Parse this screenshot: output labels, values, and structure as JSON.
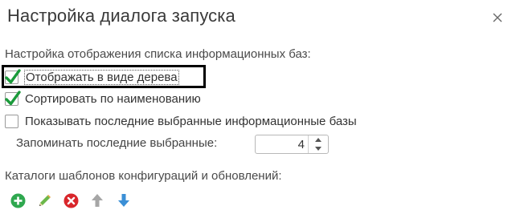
{
  "dialog": {
    "title": "Настройка диалога запуска"
  },
  "list_settings": {
    "section_label": "Настройка отображения списка информационных баз:",
    "options": [
      {
        "label": "Отображать в виде дерева",
        "checked": true
      },
      {
        "label": "Сортировать по наименованию",
        "checked": true
      },
      {
        "label": "Показывать последние выбранные информационные базы",
        "checked": false
      }
    ],
    "remember_label": "Запоминать последние выбранные:",
    "remember_value": "4"
  },
  "templates": {
    "section_label": "Каталоги шаблонов конфигураций и обновлений:",
    "toolbar_icons": [
      "add-icon",
      "edit-icon",
      "delete-icon",
      "move-up-icon",
      "move-down-icon"
    ]
  },
  "colors": {
    "check_green": "#1a9a3a",
    "add_green": "#2fa84f",
    "delete_red": "#d9262b",
    "arrow_blue": "#3b8fd6",
    "arrow_gray": "#a6a6a6"
  }
}
